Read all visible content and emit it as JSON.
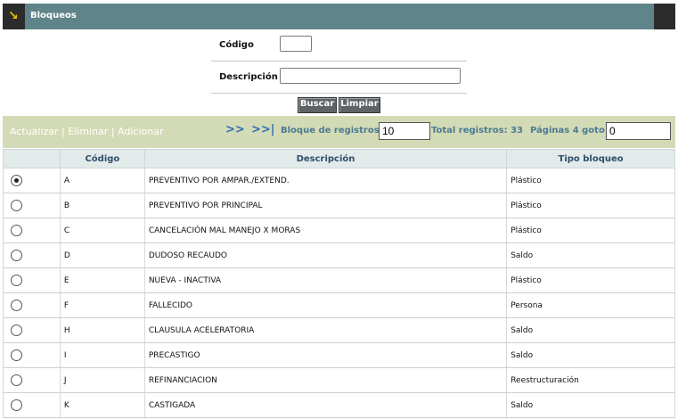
{
  "title": "Bloqueos",
  "form": {
    "codigo_label": "Código",
    "codigo_value": "",
    "descripcion_label": "Descripción",
    "descripcion_value": "",
    "buscar_label": "Buscar",
    "limpiar_label": "Limpiar"
  },
  "toolbar": {
    "actualizar": "Actualizar",
    "eliminar": "Eliminar",
    "adicionar": "Adicionar",
    "sep": " | ",
    "next": ">>",
    "last": ">>|",
    "bloque_label": "Bloque de registros:",
    "bloque_value": "10",
    "total_label": "Total registros:",
    "total_value": "33",
    "paginas_label": "Páginas 4 goto:",
    "goto_value": "0"
  },
  "table": {
    "headers": [
      "",
      "Código",
      "Descripción",
      "Tipo bloqueo"
    ],
    "rows": [
      {
        "selected": true,
        "codigo": "A",
        "descripcion": "PREVENTIVO POR AMPAR./EXTEND.",
        "tipo": "Plástico"
      },
      {
        "selected": false,
        "codigo": "B",
        "descripcion": "PREVENTIVO POR PRINCIPAL",
        "tipo": "Plástico"
      },
      {
        "selected": false,
        "codigo": "C",
        "descripcion": "CANCELACIÓN MAL MANEJO X MORAS",
        "tipo": "Plástico"
      },
      {
        "selected": false,
        "codigo": "D",
        "descripcion": "DUDOSO RECAUDO",
        "tipo": "Saldo"
      },
      {
        "selected": false,
        "codigo": "E",
        "descripcion": "NUEVA - INACTIVA",
        "tipo": "Plástico"
      },
      {
        "selected": false,
        "codigo": "F",
        "descripcion": "FALLECIDO",
        "tipo": "Persona"
      },
      {
        "selected": false,
        "codigo": "H",
        "descripcion": "CLAUSULA ACELERATORIA",
        "tipo": "Saldo"
      },
      {
        "selected": false,
        "codigo": "I",
        "descripcion": "PRECASTIGO",
        "tipo": "Saldo"
      },
      {
        "selected": false,
        "codigo": "J",
        "descripcion": "REFINANCIACION",
        "tipo": "Reestructuración"
      },
      {
        "selected": false,
        "codigo": "K",
        "descripcion": "CASTIGADA",
        "tipo": "Saldo"
      }
    ]
  }
}
